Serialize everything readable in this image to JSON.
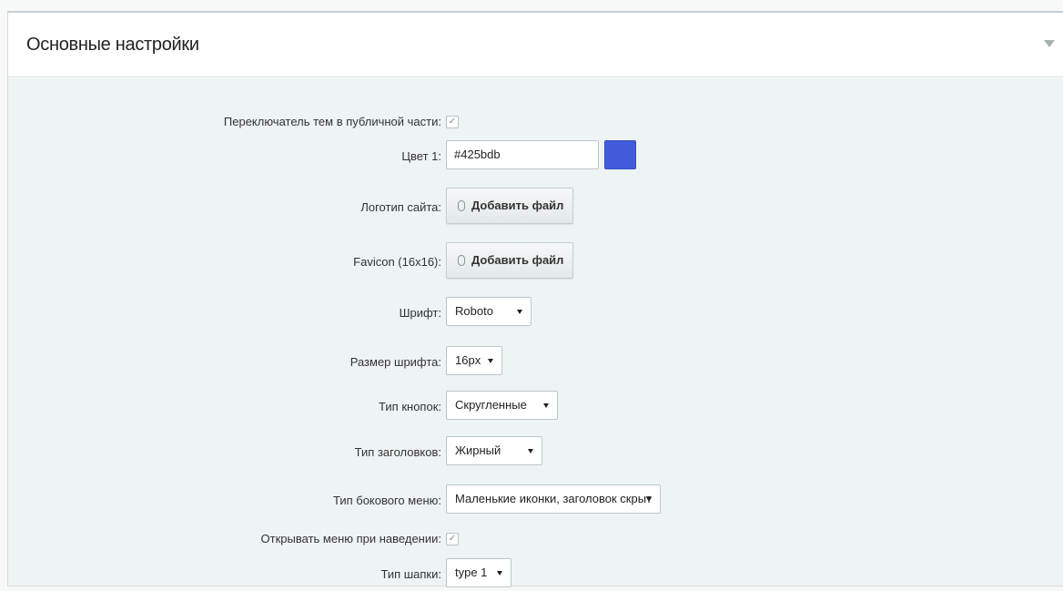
{
  "section": {
    "title": "Основные настройки"
  },
  "fields": {
    "theme_switcher": {
      "label": "Переключатель тем в публичной части:",
      "checked": true
    },
    "color1": {
      "label": "Цвет 1:",
      "value": "#425bdb",
      "swatch_color": "#425bdb"
    },
    "logo": {
      "label": "Логотип сайта:",
      "button": "Добавить файл"
    },
    "favicon": {
      "label": "Favicon (16x16):",
      "button": "Добавить файл"
    },
    "font": {
      "label": "Шрифт:",
      "selected": "Roboto"
    },
    "font_size": {
      "label": "Размер шрифта:",
      "selected": "16px"
    },
    "button_type": {
      "label": "Тип кнопок:",
      "selected": "Скругленные"
    },
    "heading_type": {
      "label": "Тип заголовков:",
      "selected": "Жирный"
    },
    "side_menu_type": {
      "label": "Тип бокового меню:",
      "selected": "Маленькие иконки, заголовок скрыт"
    },
    "open_menu_hover": {
      "label": "Открывать меню при наведении:",
      "checked": true
    },
    "header_type": {
      "label": "Тип шапки:",
      "selected": "type 1"
    }
  },
  "icons": {
    "collapse": "triangle-down-icon",
    "checkbox": "check-icon",
    "file": "paperclip-icon",
    "dropdown": "chevron-down-icon"
  }
}
